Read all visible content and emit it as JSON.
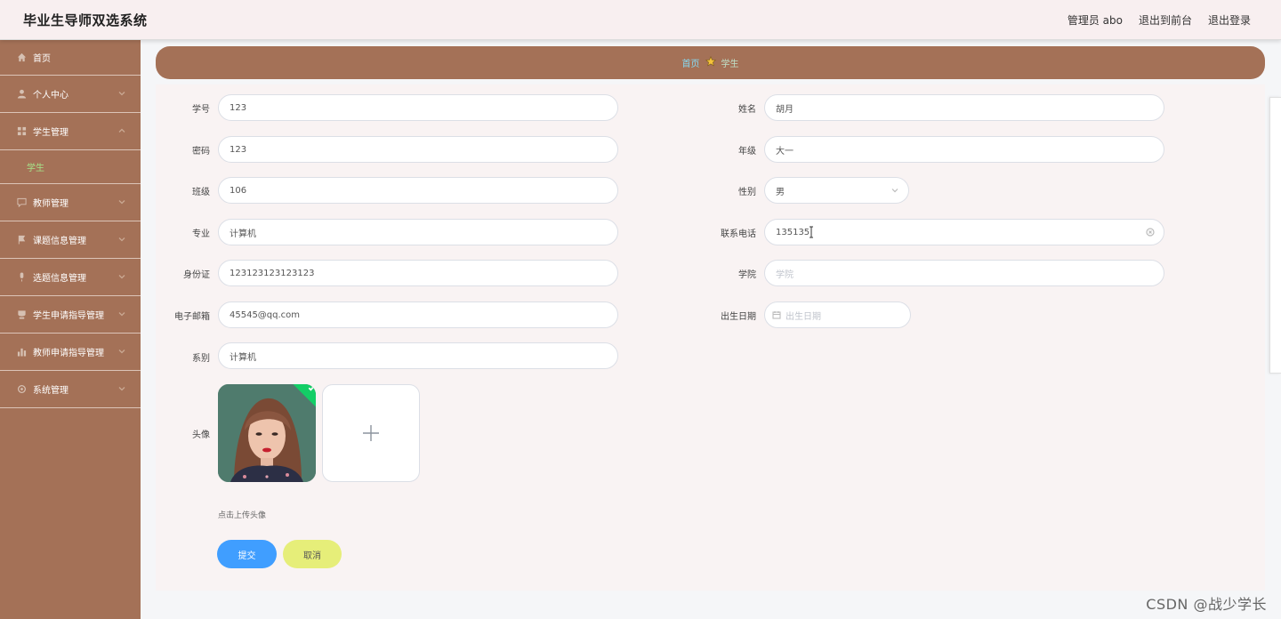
{
  "header": {
    "app_title": "毕业生导师双选系统",
    "user_label": "管理员 abo",
    "frontend_link": "退出到前台",
    "logout_link": "退出登录"
  },
  "sidebar": {
    "items": [
      {
        "label": "首页",
        "icon": "home-icon"
      },
      {
        "label": "个人中心",
        "icon": "user-icon"
      },
      {
        "label": "学生管理",
        "icon": "grid-icon"
      },
      {
        "label": "学生",
        "icon": ""
      },
      {
        "label": "教师管理",
        "icon": "chat-icon"
      },
      {
        "label": "课题信息管理",
        "icon": "flag-icon"
      },
      {
        "label": "选题信息管理",
        "icon": "mic-icon"
      },
      {
        "label": "学生申请指导管理",
        "icon": "cup-icon"
      },
      {
        "label": "教师申请指导管理",
        "icon": "bar-chart-icon"
      },
      {
        "label": "系统管理",
        "icon": "gear-icon"
      }
    ]
  },
  "breadcrumb": {
    "home": "首页",
    "current": "学生"
  },
  "form": {
    "student_id": {
      "label": "学号",
      "value": "123"
    },
    "password": {
      "label": "密码",
      "value": "123"
    },
    "class": {
      "label": "班级",
      "value": "106"
    },
    "major": {
      "label": "专业",
      "value": "计算机"
    },
    "id_card": {
      "label": "身份证",
      "value": "123123123123123"
    },
    "email": {
      "label": "电子邮箱",
      "value": "45545@qq.com"
    },
    "department": {
      "label": "系别",
      "value": "计算机"
    },
    "name": {
      "label": "姓名",
      "value": "胡月"
    },
    "grade": {
      "label": "年级",
      "value": "大一"
    },
    "gender": {
      "label": "性别",
      "value": "男"
    },
    "phone": {
      "label": "联系电话",
      "value": "135135"
    },
    "college": {
      "label": "学院",
      "placeholder": "学院"
    },
    "birthday": {
      "label": "出生日期",
      "placeholder": "出生日期"
    },
    "avatar": {
      "label": "头像",
      "tip": "点击上传头像"
    },
    "submit_label": "提交",
    "cancel_label": "取消"
  },
  "watermark": "CSDN @战少学长",
  "colors": {
    "sidebar_bg": "#a47157",
    "primary_button": "#409eff",
    "cancel_button": "#e6ee79",
    "active_submenu": "#a6e38a"
  }
}
